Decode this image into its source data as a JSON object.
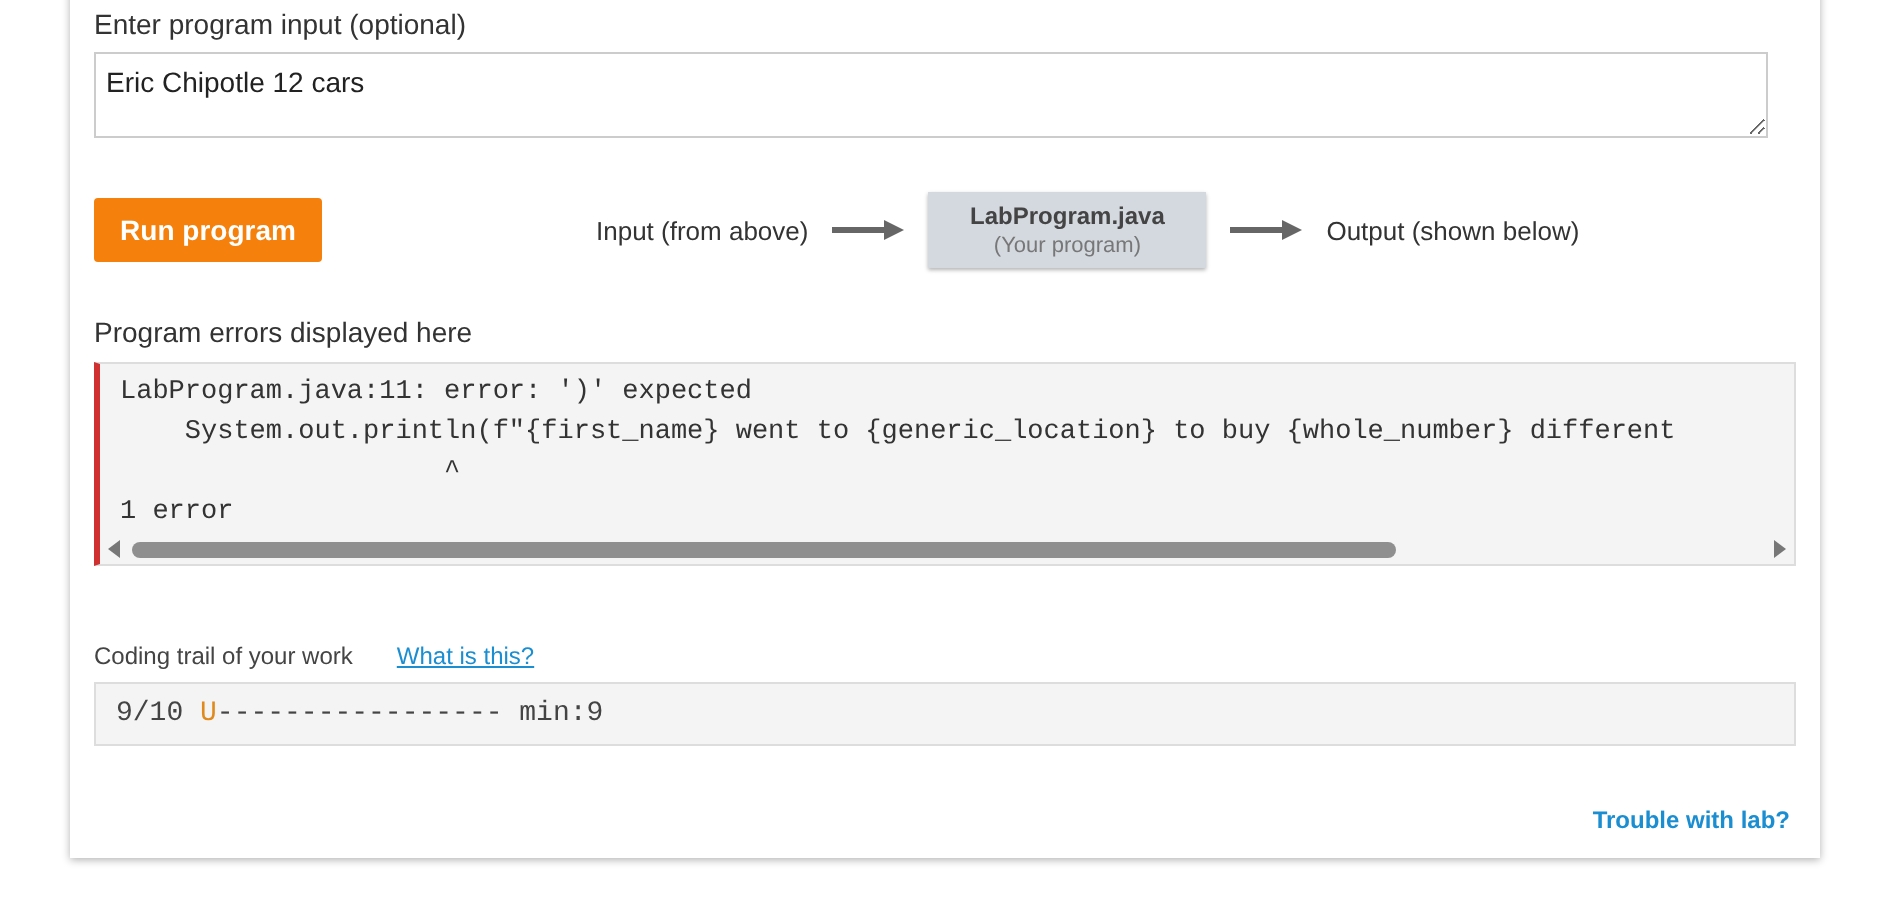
{
  "input_section": {
    "label": "Enter program input (optional)",
    "value": "Eric Chipotle 12 cars"
  },
  "run": {
    "button": "Run program",
    "flow_input": "Input (from above)",
    "program_name": "LabProgram.java",
    "program_caption": "(Your program)",
    "flow_output": "Output (shown below)"
  },
  "errors": {
    "label": "Program errors displayed here",
    "lines": [
      "LabProgram.java:11: error: ')' expected",
      "    System.out.println(f\"{first_name} went to {generic_location} to buy {whole_number} different",
      "                    ^",
      "1 error"
    ]
  },
  "coding_trail": {
    "label": "Coding trail of your work",
    "link": "What is this?",
    "segments": [
      {
        "kind": "plain",
        "text": "9/10 "
      },
      {
        "kind": "highlight",
        "text": "U"
      },
      {
        "kind": "plain",
        "text": "----------------- min:9"
      }
    ]
  },
  "footer_link": "Trouble with lab?"
}
